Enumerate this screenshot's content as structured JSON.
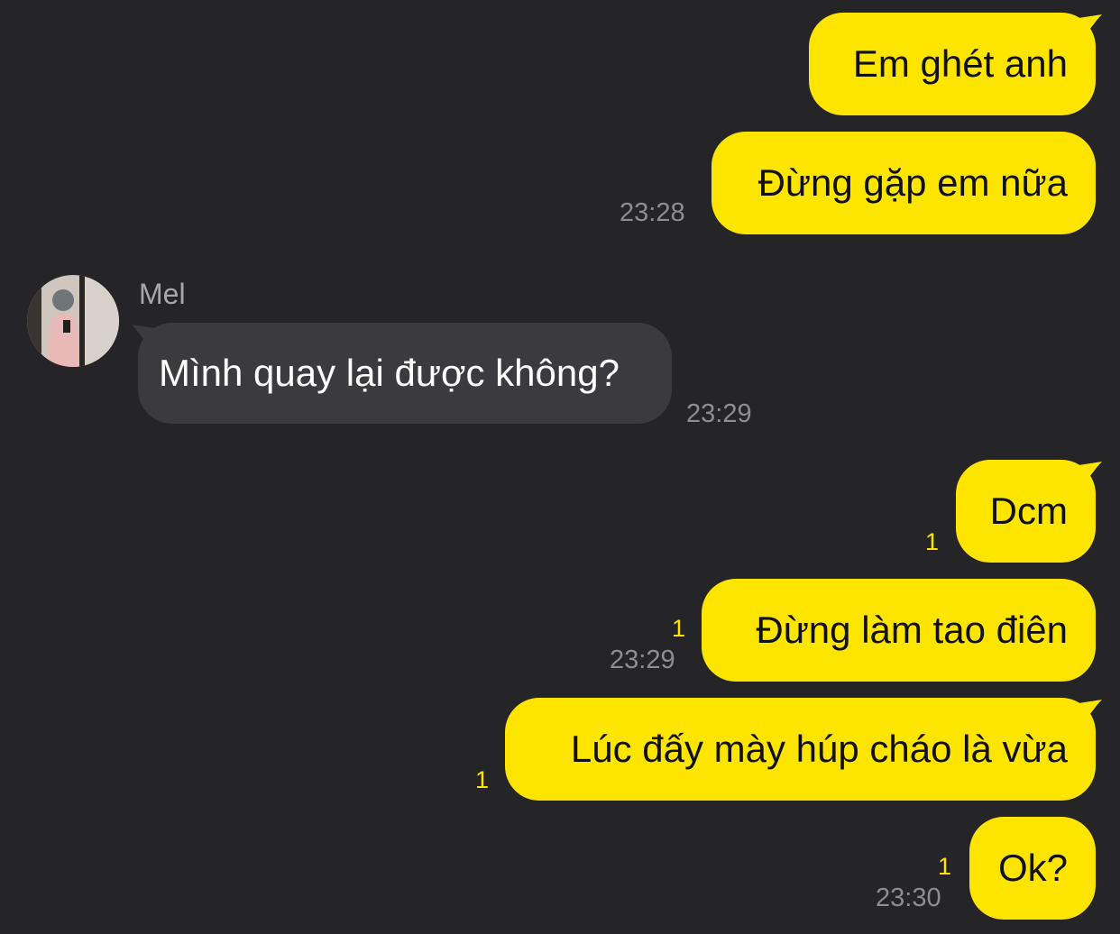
{
  "colors": {
    "background": "#252527",
    "outgoing_bubble": "#FEE500",
    "incoming_bubble": "#3B3B3D",
    "timestamp": "#8E8E90",
    "unread_count": "#FEE500"
  },
  "chat": {
    "messages": [
      {
        "text": "Em ghét anh"
      },
      {
        "text": "Đừng gặp em nữa",
        "time": "23:28"
      },
      {
        "sender": "Mel",
        "avatar": "avatar-icon",
        "text": "Mình quay lại được không?",
        "time": "23:29"
      },
      {
        "text": "Dcm",
        "unread": "1"
      },
      {
        "text": "Đừng làm tao điên",
        "unread": "1",
        "time": "23:29"
      },
      {
        "text": "Lúc đấy mày húp cháo là vừa",
        "unread": "1"
      },
      {
        "text": "Ok?",
        "unread": "1",
        "time": "23:30"
      }
    ]
  }
}
